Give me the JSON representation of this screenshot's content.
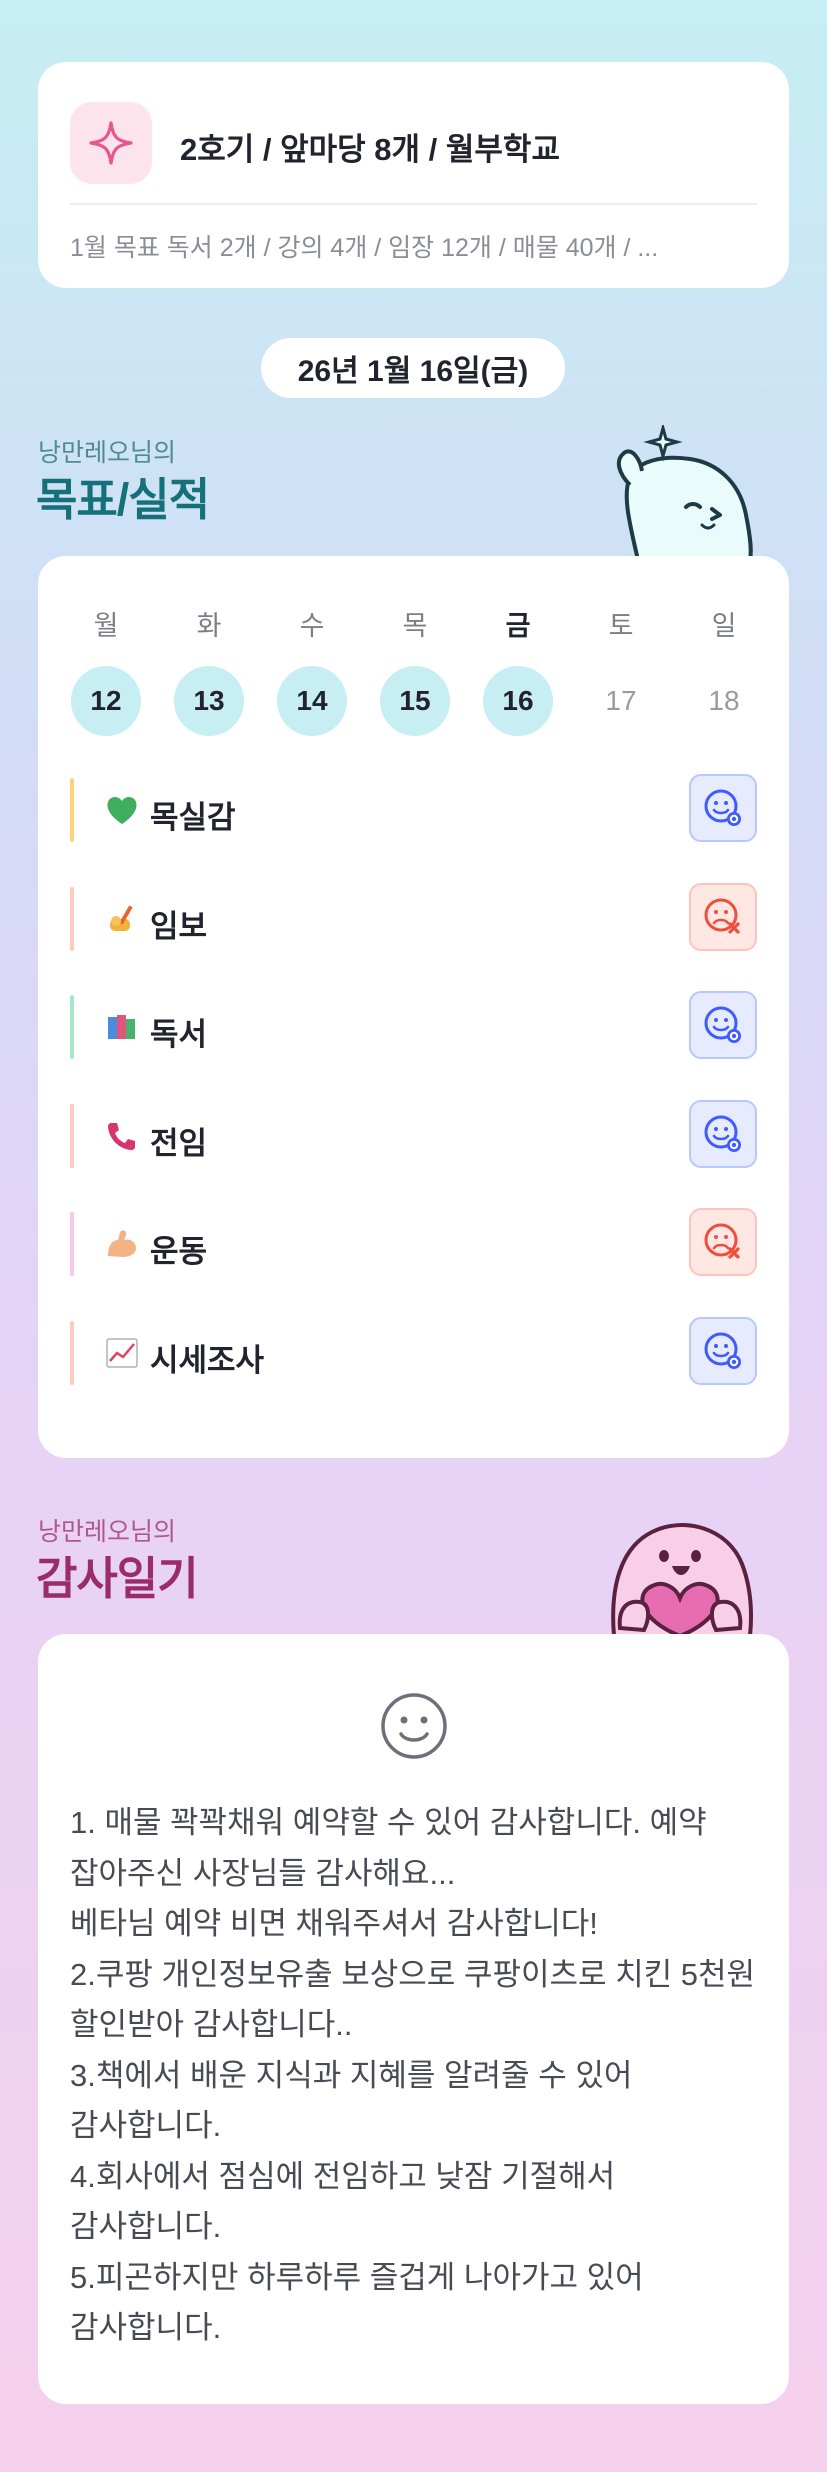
{
  "summary": {
    "title": "2호기 / 앞마당 8개 / 월부학교",
    "goal_text": "1월 목표  독서 2개 / 강의 4개 / 임장 12개 / 매물 40개 / ..."
  },
  "date": "26년 1월 16일(금)",
  "goals_section": {
    "subtitle": "낭만레오님의",
    "title": "목표/실적"
  },
  "week": [
    {
      "name": "월",
      "num": "12",
      "filled": true,
      "today": false
    },
    {
      "name": "화",
      "num": "13",
      "filled": true,
      "today": false
    },
    {
      "name": "수",
      "num": "14",
      "filled": true,
      "today": false
    },
    {
      "name": "목",
      "num": "15",
      "filled": true,
      "today": false
    },
    {
      "name": "금",
      "num": "16",
      "filled": true,
      "today": true
    },
    {
      "name": "토",
      "num": "17",
      "filled": false,
      "today": false
    },
    {
      "name": "일",
      "num": "18",
      "filled": false,
      "today": false
    }
  ],
  "goals": [
    {
      "label": "목실감",
      "icon": "green-heart-icon",
      "status": "done",
      "bar_color": "#ffd27a"
    },
    {
      "label": "임보",
      "icon": "writing-hand-icon",
      "status": "missed",
      "bar_color": "#ffc9c0"
    },
    {
      "label": "독서",
      "icon": "books-icon",
      "status": "done",
      "bar_color": "#a8e6c9"
    },
    {
      "label": "전임",
      "icon": "telephone-receiver-icon",
      "status": "done",
      "bar_color": "#ffc9c0"
    },
    {
      "label": "운동",
      "icon": "flexed-biceps-icon",
      "status": "missed",
      "bar_color": "#f7c6ea"
    },
    {
      "label": "시세조사",
      "icon": "chart-increasing-icon",
      "status": "done",
      "bar_color": "#ffc9c0"
    }
  ],
  "thanks_section": {
    "subtitle": "낭만레오님의",
    "title": "감사일기"
  },
  "thanks_text": "1. 매물 꽉꽉채워 예약할 수 있어 감사합니다. 예약 잡아주신 사장님들 감사해요...\n베타님 예약 비면 채워주셔서 감사합니다!\n2.쿠팡 개인정보유출 보상으로 쿠팡이츠로 치킨 5천원 할인받아 감사합니다..\n3.책에서 배운 지식과 지혜를 알려줄 수 있어 감사합니다.\n4.회사에서 점심에 전임하고 낮잠 기절해서 감사합니다.\n5.피곤하지만 하루하루 즐겁게 나아가고 있어 감사합니다.",
  "colors": {
    "goals_title": "#15707a",
    "thanks_title": "#9a2c6a",
    "goals_subtitle": "#4d8b93",
    "thanks_subtitle": "#b0568c"
  }
}
